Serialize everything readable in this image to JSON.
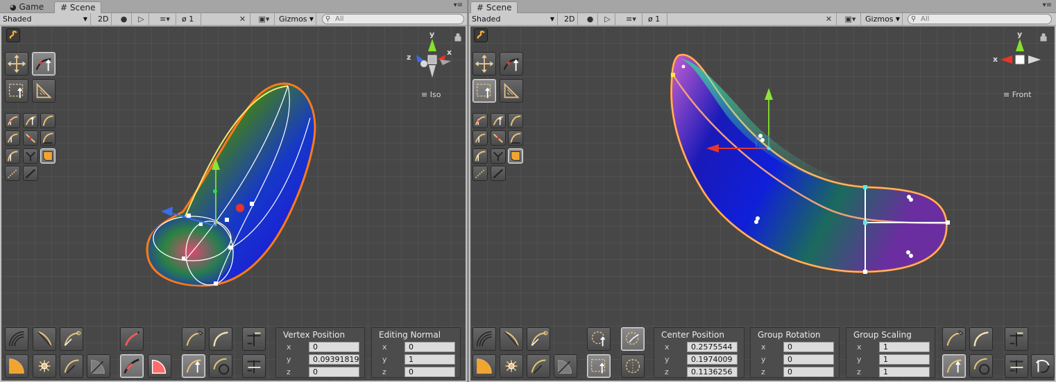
{
  "left": {
    "tabs": [
      {
        "label": "Game"
      },
      {
        "label": "Scene"
      }
    ],
    "toolbar": {
      "shading": "Shaded",
      "mode2d": "2D",
      "hidden_count": "1",
      "gizmos": "Gizmos",
      "search_placeholder": "All"
    },
    "gizmo": {
      "axis_y": "y",
      "axis_x": "x",
      "axis_z": "z",
      "view_label": "Iso"
    },
    "panels": [
      {
        "title": "Vertex Position",
        "rows": [
          {
            "label": "x",
            "value": "0"
          },
          {
            "label": "y",
            "value": "0.09391819"
          },
          {
            "label": "z",
            "value": "0"
          }
        ]
      },
      {
        "title": "Editing Normal",
        "rows": [
          {
            "label": "x",
            "value": "0"
          },
          {
            "label": "y",
            "value": "1"
          },
          {
            "label": "z",
            "value": "0"
          }
        ]
      }
    ]
  },
  "right": {
    "tabs": [
      {
        "label": "Scene"
      }
    ],
    "toolbar": {
      "shading": "Shaded",
      "mode2d": "2D",
      "hidden_count": "1",
      "gizmos": "Gizmos",
      "search_placeholder": "All"
    },
    "gizmo": {
      "axis_y": "y",
      "axis_x": "x",
      "view_label": "Front"
    },
    "panels": [
      {
        "title": "Center Position",
        "rows": [
          {
            "label": "x",
            "value": "0.2575544"
          },
          {
            "label": "y",
            "value": "0.1974009"
          },
          {
            "label": "z",
            "value": "0.1136256"
          }
        ]
      },
      {
        "title": "Group Rotation",
        "rows": [
          {
            "label": "x",
            "value": "0"
          },
          {
            "label": "y",
            "value": "0"
          },
          {
            "label": "z",
            "value": "0"
          }
        ]
      },
      {
        "title": "Group Scaling",
        "rows": [
          {
            "label": "x",
            "value": "1"
          },
          {
            "label": "y",
            "value": "1"
          },
          {
            "label": "z",
            "value": "1"
          }
        ]
      }
    ]
  },
  "icons": {
    "game_tab": "pacman-icon",
    "scene_tab": "grid-icon",
    "lighting": "bulb-icon",
    "audio": "speaker-icon",
    "effects": "stack-icon",
    "visibility": "eye-slash-icon",
    "tools": "crossed-tools-icon",
    "camera": "camera-icon",
    "search": "search-icon",
    "lock": "lock-icon",
    "menu": "hamburger-icon",
    "tool_logo": "curve-logo-icon"
  },
  "colors": {
    "accent_orange": "#ff8a1f",
    "axis_x": "#e8352a",
    "axis_y": "#7fd42b",
    "axis_z": "#3a6ee8",
    "button_bg": "#555555",
    "panel_bg": "#4c4c4c"
  }
}
